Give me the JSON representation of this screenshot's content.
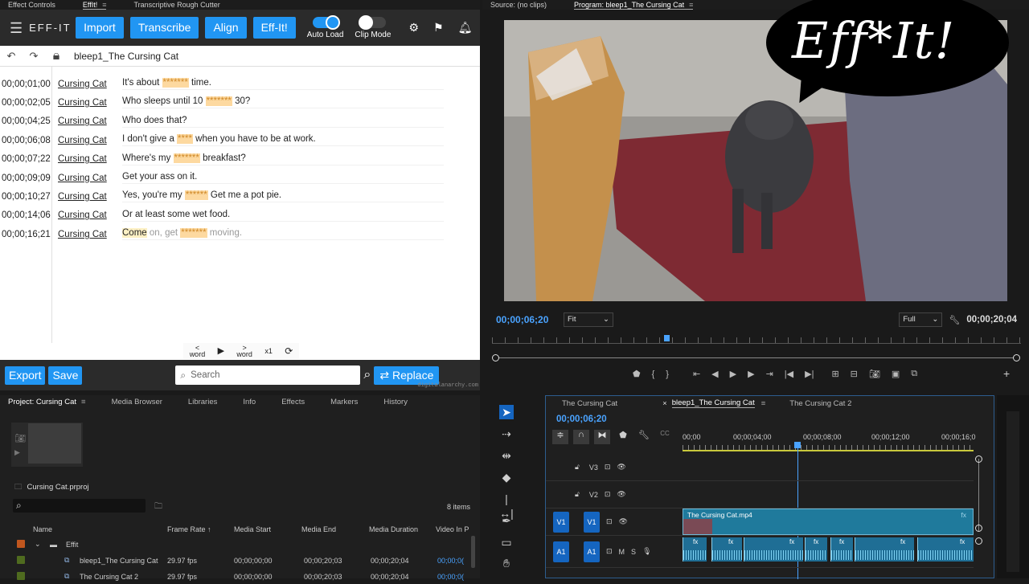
{
  "left_tabs": {
    "effect_controls": "Effect Controls",
    "effit": "EffIt!",
    "rough_cutter": "Transcriptive Rough Cutter"
  },
  "effit": {
    "brand": "EFF-IT!",
    "buttons": {
      "import": "Import",
      "transcribe": "Transcribe",
      "align": "Align",
      "effit": "Eff-It!"
    },
    "toggles": {
      "auto_load": "Auto Load",
      "clip_mode": "Clip Mode"
    },
    "clip_name": "bleep1_The Cursing Cat",
    "rows": [
      {
        "tc": "00;00;01;00",
        "speaker": "Cursing Cat",
        "parts": [
          {
            "t": "It's about "
          },
          {
            "t": "*******",
            "b": true
          },
          {
            "t": " time."
          }
        ]
      },
      {
        "tc": "00;00;02;05",
        "speaker": "Cursing Cat",
        "parts": [
          {
            "t": "Who sleeps until 10 "
          },
          {
            "t": "*******",
            "b": true
          },
          {
            "t": " 30?"
          }
        ]
      },
      {
        "tc": "00;00;04;25",
        "speaker": "Cursing Cat",
        "parts": [
          {
            "t": "Who does that?"
          }
        ]
      },
      {
        "tc": "00;00;06;08",
        "speaker": "Cursing Cat",
        "parts": [
          {
            "t": "I don't give a "
          },
          {
            "t": "****",
            "b": true
          },
          {
            "t": " when you have to be at work."
          }
        ]
      },
      {
        "tc": "00;00;07;22",
        "speaker": "Cursing Cat",
        "parts": [
          {
            "t": "Where's my "
          },
          {
            "t": "*******",
            "b": true
          },
          {
            "t": " breakfast?"
          }
        ]
      },
      {
        "tc": "00;00;09;09",
        "speaker": "Cursing Cat",
        "parts": [
          {
            "t": "Get your ass on it."
          }
        ]
      },
      {
        "tc": "00;00;10;27",
        "speaker": "Cursing Cat",
        "parts": [
          {
            "t": "Yes, you're my "
          },
          {
            "t": "******",
            "b": true
          },
          {
            "t": " Get me a pot pie."
          }
        ]
      },
      {
        "tc": "00;00;14;06",
        "speaker": "Cursing Cat",
        "parts": [
          {
            "t": "Or at least some wet food."
          }
        ]
      },
      {
        "tc": "00;00;16;21",
        "speaker": "Cursing Cat",
        "parts": [
          {
            "t": "Come",
            "hl": true
          },
          {
            "t": " on, get ",
            "d": true
          },
          {
            "t": "*******",
            "b": true
          },
          {
            "t": " moving.",
            "d": true
          }
        ]
      }
    ],
    "transport": {
      "prev_word": "word",
      "next_word": "word",
      "speed": "x1"
    },
    "bottom": {
      "export": "Export",
      "save": "Save",
      "search_placeholder": "Search",
      "replace": "Replace",
      "footer_url": "digitalanarchy.com"
    }
  },
  "program": {
    "tab_source": "Source: (no clips)",
    "tab_program": "Program: bleep1_The Cursing Cat",
    "bubble_text": "Eff*It!",
    "current_tc": "00;00;06;20",
    "fit": "Fit",
    "quality": "Full",
    "duration_tc": "00;00;20;04"
  },
  "project": {
    "tabs": [
      "Project: Cursing Cat",
      "Media Browser",
      "Libraries",
      "Info",
      "Effects",
      "Markers",
      "History"
    ],
    "file": "Cursing Cat.prproj",
    "item_count": "8 items",
    "columns": [
      "Name",
      "Frame Rate",
      "Media Start",
      "Media End",
      "Media Duration",
      "Video In P"
    ],
    "rows": [
      {
        "name": "Effit",
        "fr": "",
        "ms": "",
        "me": "",
        "md": "",
        "vi": "",
        "color": "#c0561e",
        "folder": true
      },
      {
        "name": "bleep1_The Cursing Cat",
        "fr": "29.97 fps",
        "ms": "00;00;00;00",
        "me": "00;00;20;03",
        "md": "00;00;20;04",
        "vi": "00;00;0(",
        "color": "#4f6b1f"
      },
      {
        "name": "The Cursing Cat 2",
        "fr": "29.97 fps",
        "ms": "00;00;00;00",
        "me": "00;00;20;03",
        "md": "00;00;20;04",
        "vi": "00;00;0(",
        "color": "#4f6b1f"
      }
    ]
  },
  "timeline": {
    "tabs": [
      "The Cursing Cat",
      "bleep1_The Cursing Cat",
      "The Cursing Cat 2"
    ],
    "current_tc": "00;00;06;20",
    "ruler": [
      "00;00",
      "00;00;04;00",
      "00;00;08;00",
      "00;00;12;00",
      "00;00;16;0"
    ],
    "tracks": [
      "V3",
      "V2",
      "V1",
      "A1"
    ],
    "source_v": "V1",
    "source_a": "A1",
    "clip_name": "The Cursing Cat.mp4",
    "audio_fx": "fx",
    "track_m": "M",
    "track_s": "S"
  }
}
